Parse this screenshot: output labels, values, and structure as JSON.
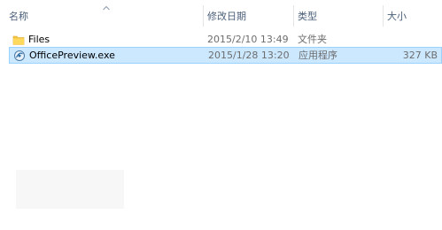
{
  "columns": {
    "name": "名称",
    "date": "修改日期",
    "type": "类型",
    "size": "大小"
  },
  "files": [
    {
      "name": "Files",
      "date": "2015/2/10 13:49",
      "type": "文件夹",
      "size": "",
      "icon": "folder-icon",
      "selected": false
    },
    {
      "name": "OfficePreview.exe",
      "date": "2015/1/28 13:20",
      "type": "应用程序",
      "size": "327 KB",
      "icon": "exe-app-icon",
      "selected": true
    }
  ],
  "colors": {
    "selection_bg": "#cce8ff",
    "selection_border": "#99d1ff",
    "header_text": "#4c607a",
    "folder_yellow": "#f4c542"
  }
}
